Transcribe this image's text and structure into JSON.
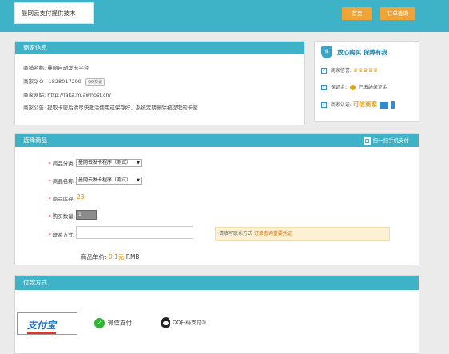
{
  "header": {
    "logo_text": "曼网云支付提供技术",
    "home_label": "首页",
    "order_query_label": "订单查询"
  },
  "merchant": {
    "title": "商家信息",
    "shop_name_label": "商铺名称:",
    "shop_name": "曼网自动发卡平台",
    "qq_label": "商家Q Q :",
    "qq_number": "1828017299",
    "qq_badge": "QQ交谈",
    "website_label": "商家网站:",
    "website": "http://faka.m.awhost.cn/",
    "notice_label": "商家公告:",
    "notice": "提取卡密后请尽快激活使用或保存好，系统定期删除被提取的卡密"
  },
  "guarantee": {
    "shield_text": "保",
    "title": "放心购买  保障有我",
    "reputation_label": "商家信誉:",
    "crowns": "♛♛♛♛♛",
    "deposit_label": "保证金:",
    "deposit_text": "已缴纳保证金",
    "cert_label": "商家认证:",
    "cert_text": "可信商家"
  },
  "product": {
    "title": "选择商品",
    "scan_label": "扫一扫手机支付",
    "category_label": "商品分类:",
    "category_value": "曼网云发卡程序（测试）",
    "name_label": "商品名称:",
    "name_value": "曼网云发卡程序（测试）",
    "stock_label": "商品库存:",
    "stock_value": "23",
    "qty_label": "购买数量:",
    "qty_value": "1",
    "contact_label": "联系方式:",
    "hint_prefix": "请填写联系方式 ",
    "hint_emphasis": "订单查询重要凭证",
    "price_label": "商品单价: ",
    "price_value": "0.1元",
    "price_unit": " RMB"
  },
  "payment": {
    "title": "付款方式",
    "alipay_label": "支付宝",
    "wechat_label": "微信支付",
    "qq_label": "QQ扫码支付①"
  }
}
